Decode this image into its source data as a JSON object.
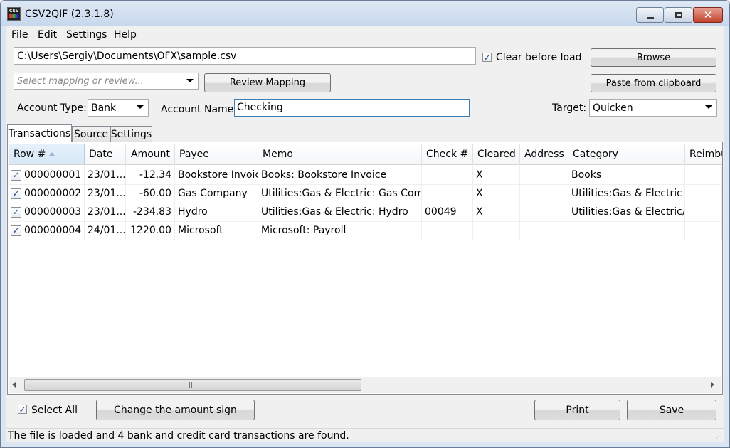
{
  "window": {
    "title": "CSV2QIF (2.3.1.8)",
    "icon": "csv2qif-app-icon"
  },
  "caption_buttons": {
    "minimize": "minimize-icon",
    "maximize": "maximize-icon",
    "close": "close-icon"
  },
  "menu": [
    "File",
    "Edit",
    "Settings",
    "Help"
  ],
  "file_path": {
    "value": "C:\\Users\\Sergiy\\Documents\\OFX\\sample.csv"
  },
  "clear_before_load": {
    "label": "Clear before load",
    "checked": true
  },
  "browse_button": "Browse",
  "mapping_select": {
    "placeholder": "Select mapping or review..."
  },
  "review_mapping_button": "Review Mapping",
  "paste_button": "Paste from clipboard",
  "account_type": {
    "label": "Account Type:",
    "value": "Bank"
  },
  "account_name": {
    "label": "Account Name:",
    "value": "Checking"
  },
  "target": {
    "label": "Target:",
    "value": "Quicken"
  },
  "tabs": [
    "Transactions",
    "Source",
    "Settings"
  ],
  "grid": {
    "columns": [
      "Row #",
      "Date",
      "Amount",
      "Payee",
      "Memo",
      "Check #",
      "Cleared",
      "Address",
      "Category",
      "Reimbu"
    ],
    "rows": [
      {
        "checked": true,
        "row": "000000001",
        "date": "23/01...",
        "amount": "-12.34",
        "payee": "Bookstore Invoice",
        "memo": "Books: Bookstore Invoice",
        "check": "",
        "cleared": "X",
        "address": "",
        "category": "Books"
      },
      {
        "checked": true,
        "row": "000000002",
        "date": "23/01...",
        "amount": "-60.00",
        "payee": "Gas Company",
        "memo": "Utilities:Gas & Electric: Gas Company",
        "check": "",
        "cleared": "X",
        "address": "",
        "category": "Utilities:Gas & Electric /tag"
      },
      {
        "checked": true,
        "row": "000000003",
        "date": "23/01...",
        "amount": "-234.83",
        "payee": "Hydro",
        "memo": "Utilities:Gas & Electric: Hydro",
        "check": "00049",
        "cleared": "X",
        "address": "",
        "category": "Utilities:Gas & Electric/tag"
      },
      {
        "checked": true,
        "row": "000000004",
        "date": "24/01...",
        "amount": "1220.00",
        "payee": "Microsoft",
        "memo": "Microsoft: Payroll",
        "check": "",
        "cleared": "",
        "address": "",
        "category": ""
      }
    ]
  },
  "select_all": {
    "label": "Select All",
    "checked": true
  },
  "change_sign_button": "Change the amount sign",
  "print_button": "Print",
  "save_button": "Save",
  "status": "The file is loaded and 4 bank and credit card transactions are found.",
  "check_glyph": "✓"
}
